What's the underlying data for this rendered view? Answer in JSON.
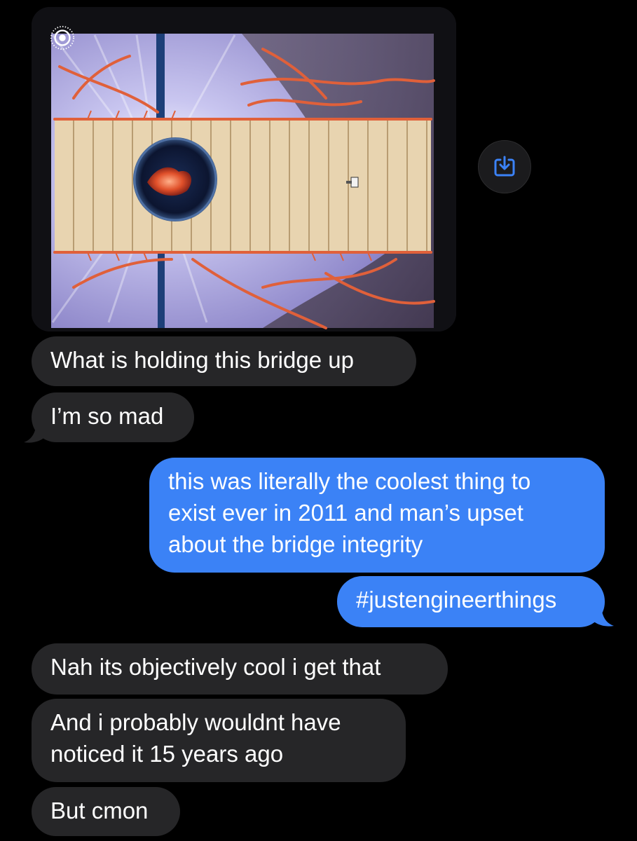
{
  "conversation": {
    "image_message": {
      "live_photo_icon": "live-photo-icon",
      "save_icon": "download-to-photos-icon"
    },
    "messages": [
      {
        "id": "m1",
        "sender": "them",
        "lines": [
          "What is holding this bridge up"
        ]
      },
      {
        "id": "m2",
        "sender": "them",
        "lines": [
          "I’m so mad"
        ]
      },
      {
        "id": "m3",
        "sender": "me",
        "lines": [
          "this was literally the coolest thing to",
          "exist ever in 2011 and man’s upset",
          "about the bridge integrity"
        ]
      },
      {
        "id": "m4",
        "sender": "me",
        "lines": [
          "#justengineerthings"
        ]
      },
      {
        "id": "m5",
        "sender": "them",
        "lines": [
          "Nah its objectively cool i get that"
        ]
      },
      {
        "id": "m6",
        "sender": "them",
        "lines": [
          "And i probably wouldnt have",
          "noticed it 15 years ago"
        ]
      },
      {
        "id": "m7",
        "sender": "them",
        "lines": [
          "But cmon"
        ]
      }
    ]
  },
  "colors": {
    "background": "#000000",
    "incoming_bubble": "#262628",
    "outgoing_bubble": "#3b82f6",
    "save_icon": "#3b82f6"
  }
}
